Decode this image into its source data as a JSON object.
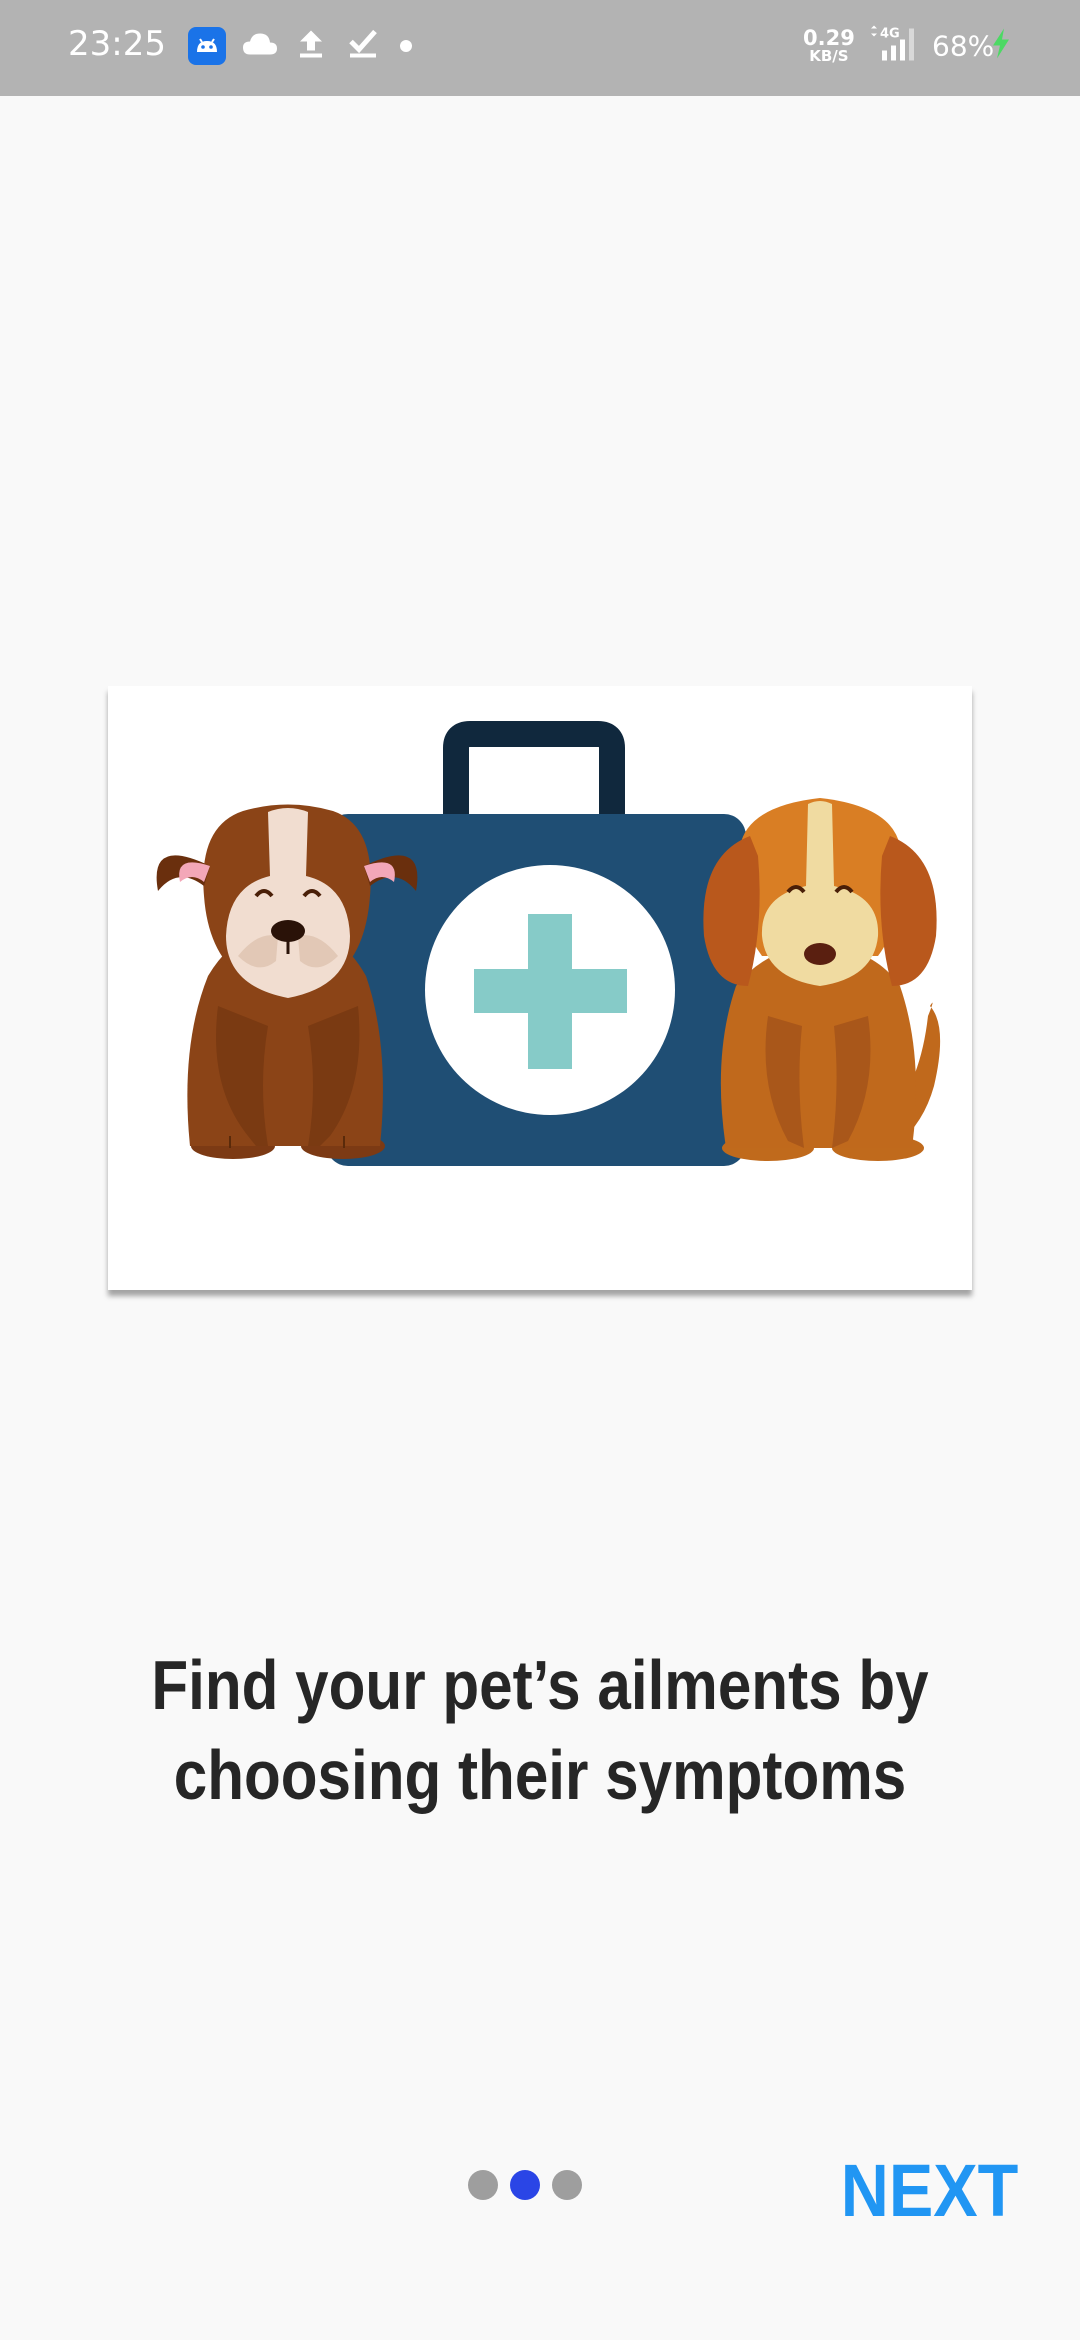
{
  "status_bar": {
    "time": "23:25",
    "net_speed_value": "0.29",
    "net_speed_unit": "KB/S",
    "network_type": "4G",
    "battery": "68%",
    "icons": [
      "app-notification-icon",
      "cloud-icon",
      "upload-icon",
      "download-done-icon",
      "more-notifications-dot-icon",
      "signal-icon",
      "charging-bolt-icon"
    ]
  },
  "onboarding": {
    "illustration": "pets-with-first-aid-kit",
    "headline": "Find your pet’s ailments by choosing their symptoms",
    "pager": {
      "total": 3,
      "active_index": 1
    },
    "next_label": "NEXT"
  },
  "colors": {
    "accent": "#2196f3",
    "active_dot": "#2a45e6",
    "inactive_dot": "#9e9e9e",
    "status_bar": "#b3b3b3",
    "kit": "#1f4e74",
    "cross": "#86cbc8"
  }
}
